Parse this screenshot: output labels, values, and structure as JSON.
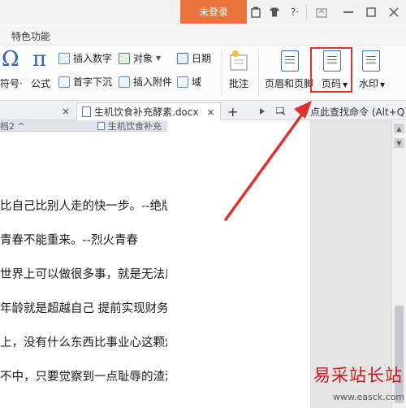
{
  "titlebar": {
    "login_label": "未登录",
    "help_label": "?·"
  },
  "menu": {
    "special_features": "特色功能"
  },
  "ribbon": {
    "symbol_label": "符号·",
    "formula_label": "公式",
    "insert_number": "插入数字",
    "object": "对象",
    "date": "日期",
    "dropcap": "首字下沉",
    "attachment": "插入附件",
    "field": "域",
    "comment": "批注",
    "header_footer": "页眉和页脚",
    "page_number": "页码",
    "watermark": "水印"
  },
  "tabs": {
    "active_doc": "生机饮食补充酵素.docx",
    "search_command": "点此查找命令 (Alt+Q)",
    "sub_left": "档2 ^",
    "sub_doc": "生机饮食补充"
  },
  "document": {
    "lines": [
      "比自己比别人走的快一步。--绝版金",
      "青春不能重来。--烈火青春",
      "世界上可以做很多事，就是无法用钱",
      "年龄就是超越自己 提前实现财务",
      "上，没有什么东西比事业心这颗灿烂",
      "不中，只要觉察到一点耻辱的渣滓就"
    ]
  },
  "watermark": {
    "text": "易采站长站",
    "url": "www.easck.com"
  },
  "colors": {
    "login": "#e8743b",
    "highlight": "#e03030",
    "accent": "#3c6fb8",
    "watermark": "#c8161d"
  }
}
